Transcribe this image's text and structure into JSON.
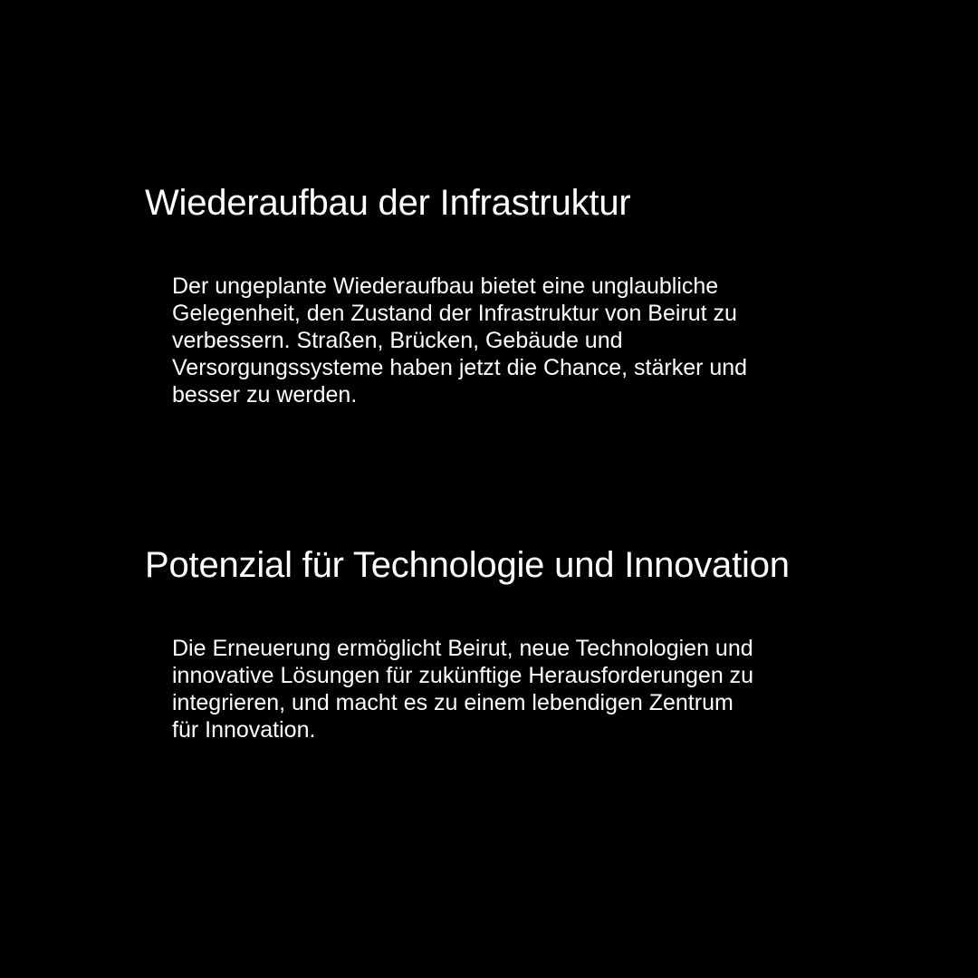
{
  "sections": [
    {
      "title": "Wiederaufbau der Infrastruktur",
      "text": "Der ungeplante Wiederaufbau bietet eine unglaubliche Gelegenheit, den Zustand der Infrastruktur von Beirut zu verbessern. Straßen, Brücken, Gebäude und Versorgungssysteme haben jetzt die Chance, stärker und besser zu werden."
    },
    {
      "title": "Potenzial für Technologie und Innovation",
      "text": "Die Erneuerung ermöglicht Beirut, neue Technologien und innovative Lösungen für zukünftige Herausforderungen zu integrieren, und macht es zu einem lebendigen Zentrum für Innovation."
    }
  ],
  "colors": {
    "background": "#000000",
    "text": "#ffffff"
  }
}
